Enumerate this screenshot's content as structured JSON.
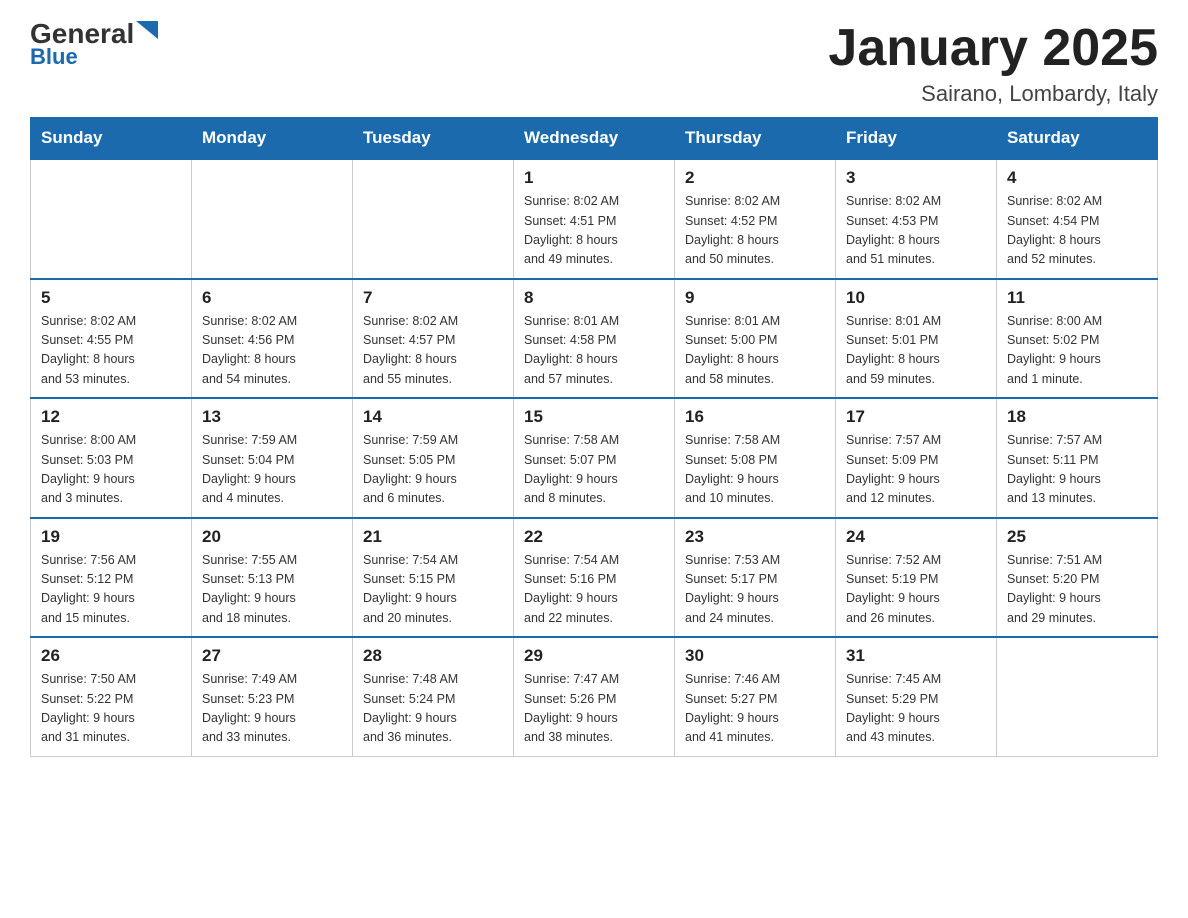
{
  "logo": {
    "general": "General",
    "arrow": "▲",
    "blue": "Blue"
  },
  "title": "January 2025",
  "subtitle": "Sairano, Lombardy, Italy",
  "days_header": [
    "Sunday",
    "Monday",
    "Tuesday",
    "Wednesday",
    "Thursday",
    "Friday",
    "Saturday"
  ],
  "weeks": [
    [
      {
        "day": "",
        "info": ""
      },
      {
        "day": "",
        "info": ""
      },
      {
        "day": "",
        "info": ""
      },
      {
        "day": "1",
        "info": "Sunrise: 8:02 AM\nSunset: 4:51 PM\nDaylight: 8 hours\nand 49 minutes."
      },
      {
        "day": "2",
        "info": "Sunrise: 8:02 AM\nSunset: 4:52 PM\nDaylight: 8 hours\nand 50 minutes."
      },
      {
        "day": "3",
        "info": "Sunrise: 8:02 AM\nSunset: 4:53 PM\nDaylight: 8 hours\nand 51 minutes."
      },
      {
        "day": "4",
        "info": "Sunrise: 8:02 AM\nSunset: 4:54 PM\nDaylight: 8 hours\nand 52 minutes."
      }
    ],
    [
      {
        "day": "5",
        "info": "Sunrise: 8:02 AM\nSunset: 4:55 PM\nDaylight: 8 hours\nand 53 minutes."
      },
      {
        "day": "6",
        "info": "Sunrise: 8:02 AM\nSunset: 4:56 PM\nDaylight: 8 hours\nand 54 minutes."
      },
      {
        "day": "7",
        "info": "Sunrise: 8:02 AM\nSunset: 4:57 PM\nDaylight: 8 hours\nand 55 minutes."
      },
      {
        "day": "8",
        "info": "Sunrise: 8:01 AM\nSunset: 4:58 PM\nDaylight: 8 hours\nand 57 minutes."
      },
      {
        "day": "9",
        "info": "Sunrise: 8:01 AM\nSunset: 5:00 PM\nDaylight: 8 hours\nand 58 minutes."
      },
      {
        "day": "10",
        "info": "Sunrise: 8:01 AM\nSunset: 5:01 PM\nDaylight: 8 hours\nand 59 minutes."
      },
      {
        "day": "11",
        "info": "Sunrise: 8:00 AM\nSunset: 5:02 PM\nDaylight: 9 hours\nand 1 minute."
      }
    ],
    [
      {
        "day": "12",
        "info": "Sunrise: 8:00 AM\nSunset: 5:03 PM\nDaylight: 9 hours\nand 3 minutes."
      },
      {
        "day": "13",
        "info": "Sunrise: 7:59 AM\nSunset: 5:04 PM\nDaylight: 9 hours\nand 4 minutes."
      },
      {
        "day": "14",
        "info": "Sunrise: 7:59 AM\nSunset: 5:05 PM\nDaylight: 9 hours\nand 6 minutes."
      },
      {
        "day": "15",
        "info": "Sunrise: 7:58 AM\nSunset: 5:07 PM\nDaylight: 9 hours\nand 8 minutes."
      },
      {
        "day": "16",
        "info": "Sunrise: 7:58 AM\nSunset: 5:08 PM\nDaylight: 9 hours\nand 10 minutes."
      },
      {
        "day": "17",
        "info": "Sunrise: 7:57 AM\nSunset: 5:09 PM\nDaylight: 9 hours\nand 12 minutes."
      },
      {
        "day": "18",
        "info": "Sunrise: 7:57 AM\nSunset: 5:11 PM\nDaylight: 9 hours\nand 13 minutes."
      }
    ],
    [
      {
        "day": "19",
        "info": "Sunrise: 7:56 AM\nSunset: 5:12 PM\nDaylight: 9 hours\nand 15 minutes."
      },
      {
        "day": "20",
        "info": "Sunrise: 7:55 AM\nSunset: 5:13 PM\nDaylight: 9 hours\nand 18 minutes."
      },
      {
        "day": "21",
        "info": "Sunrise: 7:54 AM\nSunset: 5:15 PM\nDaylight: 9 hours\nand 20 minutes."
      },
      {
        "day": "22",
        "info": "Sunrise: 7:54 AM\nSunset: 5:16 PM\nDaylight: 9 hours\nand 22 minutes."
      },
      {
        "day": "23",
        "info": "Sunrise: 7:53 AM\nSunset: 5:17 PM\nDaylight: 9 hours\nand 24 minutes."
      },
      {
        "day": "24",
        "info": "Sunrise: 7:52 AM\nSunset: 5:19 PM\nDaylight: 9 hours\nand 26 minutes."
      },
      {
        "day": "25",
        "info": "Sunrise: 7:51 AM\nSunset: 5:20 PM\nDaylight: 9 hours\nand 29 minutes."
      }
    ],
    [
      {
        "day": "26",
        "info": "Sunrise: 7:50 AM\nSunset: 5:22 PM\nDaylight: 9 hours\nand 31 minutes."
      },
      {
        "day": "27",
        "info": "Sunrise: 7:49 AM\nSunset: 5:23 PM\nDaylight: 9 hours\nand 33 minutes."
      },
      {
        "day": "28",
        "info": "Sunrise: 7:48 AM\nSunset: 5:24 PM\nDaylight: 9 hours\nand 36 minutes."
      },
      {
        "day": "29",
        "info": "Sunrise: 7:47 AM\nSunset: 5:26 PM\nDaylight: 9 hours\nand 38 minutes."
      },
      {
        "day": "30",
        "info": "Sunrise: 7:46 AM\nSunset: 5:27 PM\nDaylight: 9 hours\nand 41 minutes."
      },
      {
        "day": "31",
        "info": "Sunrise: 7:45 AM\nSunset: 5:29 PM\nDaylight: 9 hours\nand 43 minutes."
      },
      {
        "day": "",
        "info": ""
      }
    ]
  ]
}
